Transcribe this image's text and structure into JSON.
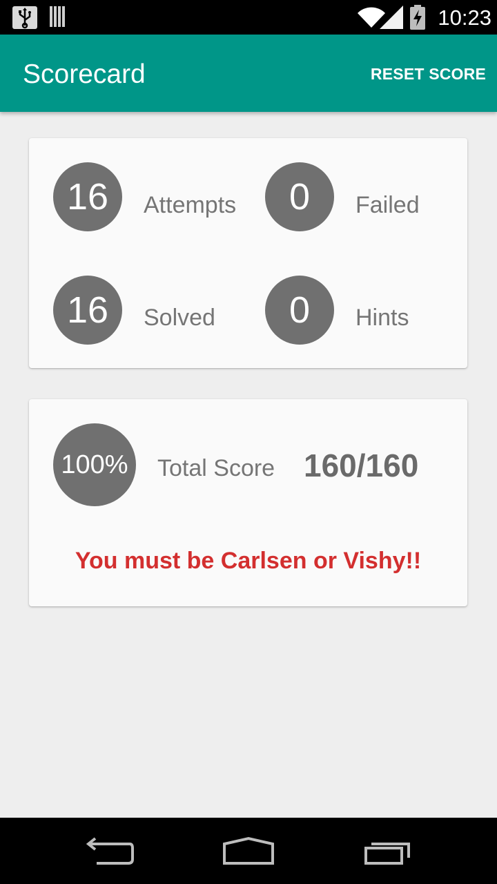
{
  "status_bar": {
    "time": "10:23",
    "icons": [
      "usb-icon",
      "barcode-icon",
      "wifi-icon",
      "signal-icon",
      "battery-charging-icon"
    ]
  },
  "app_bar": {
    "title": "Scorecard",
    "action_label": "RESET SCORE"
  },
  "stats": {
    "attempts": {
      "value": "16",
      "label": "Attempts"
    },
    "failed": {
      "value": "0",
      "label": "Failed"
    },
    "solved": {
      "value": "16",
      "label": "Solved"
    },
    "hints": {
      "value": "0",
      "label": "Hints"
    }
  },
  "score": {
    "percent": "100%",
    "label": "Total Score",
    "value": "160/160",
    "message": "You must be Carlsen or Vishy!!"
  },
  "colors": {
    "app_bar": "#009688",
    "circle": "#707070",
    "message": "#d32f2f",
    "background": "#eeeeee"
  },
  "nav_bar": {
    "icons": [
      "back-icon",
      "home-icon",
      "recents-icon"
    ]
  }
}
